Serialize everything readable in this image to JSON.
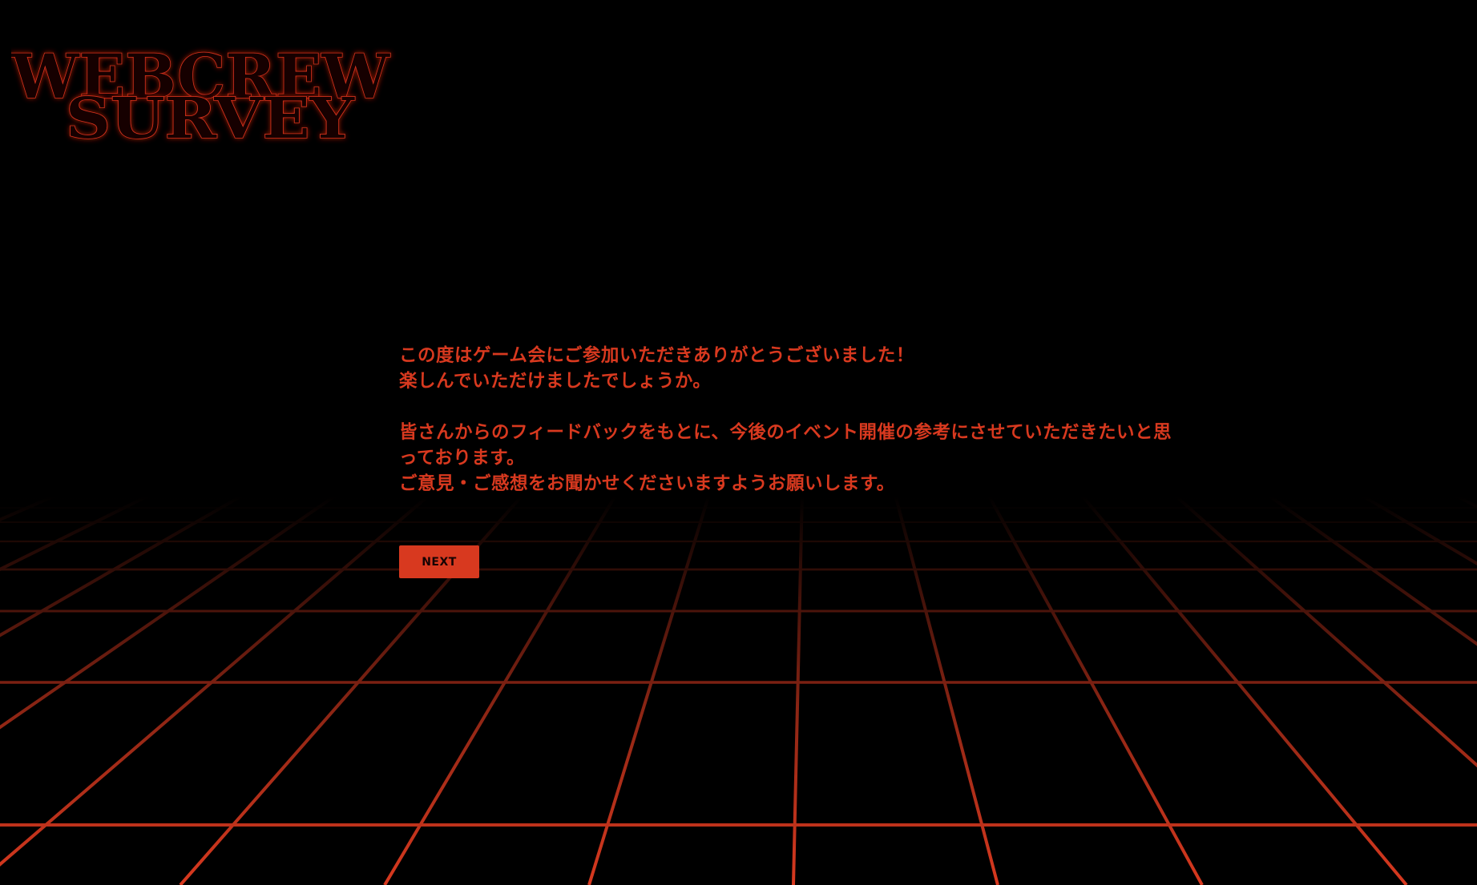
{
  "logo": {
    "line1": "WEBCREW",
    "line2": "SURVEY"
  },
  "intro": {
    "line1": "この度はゲーム会にご参加いただきありがとうございました！",
    "line2": "楽しんでいただけましたでしょうか。",
    "line3": "皆さんからのフィードバックをもとに、今後のイベント開催の参考にさせていただきたいと思",
    "line4": "っております。",
    "line5": "ご意見・ご感想をお聞かせくださいますようお願いします。"
  },
  "next_button": {
    "label": "NEXT"
  },
  "colors": {
    "background": "#000000",
    "accent": "#d8391f",
    "logo_fill": "#170404",
    "button_text": "#160303"
  }
}
